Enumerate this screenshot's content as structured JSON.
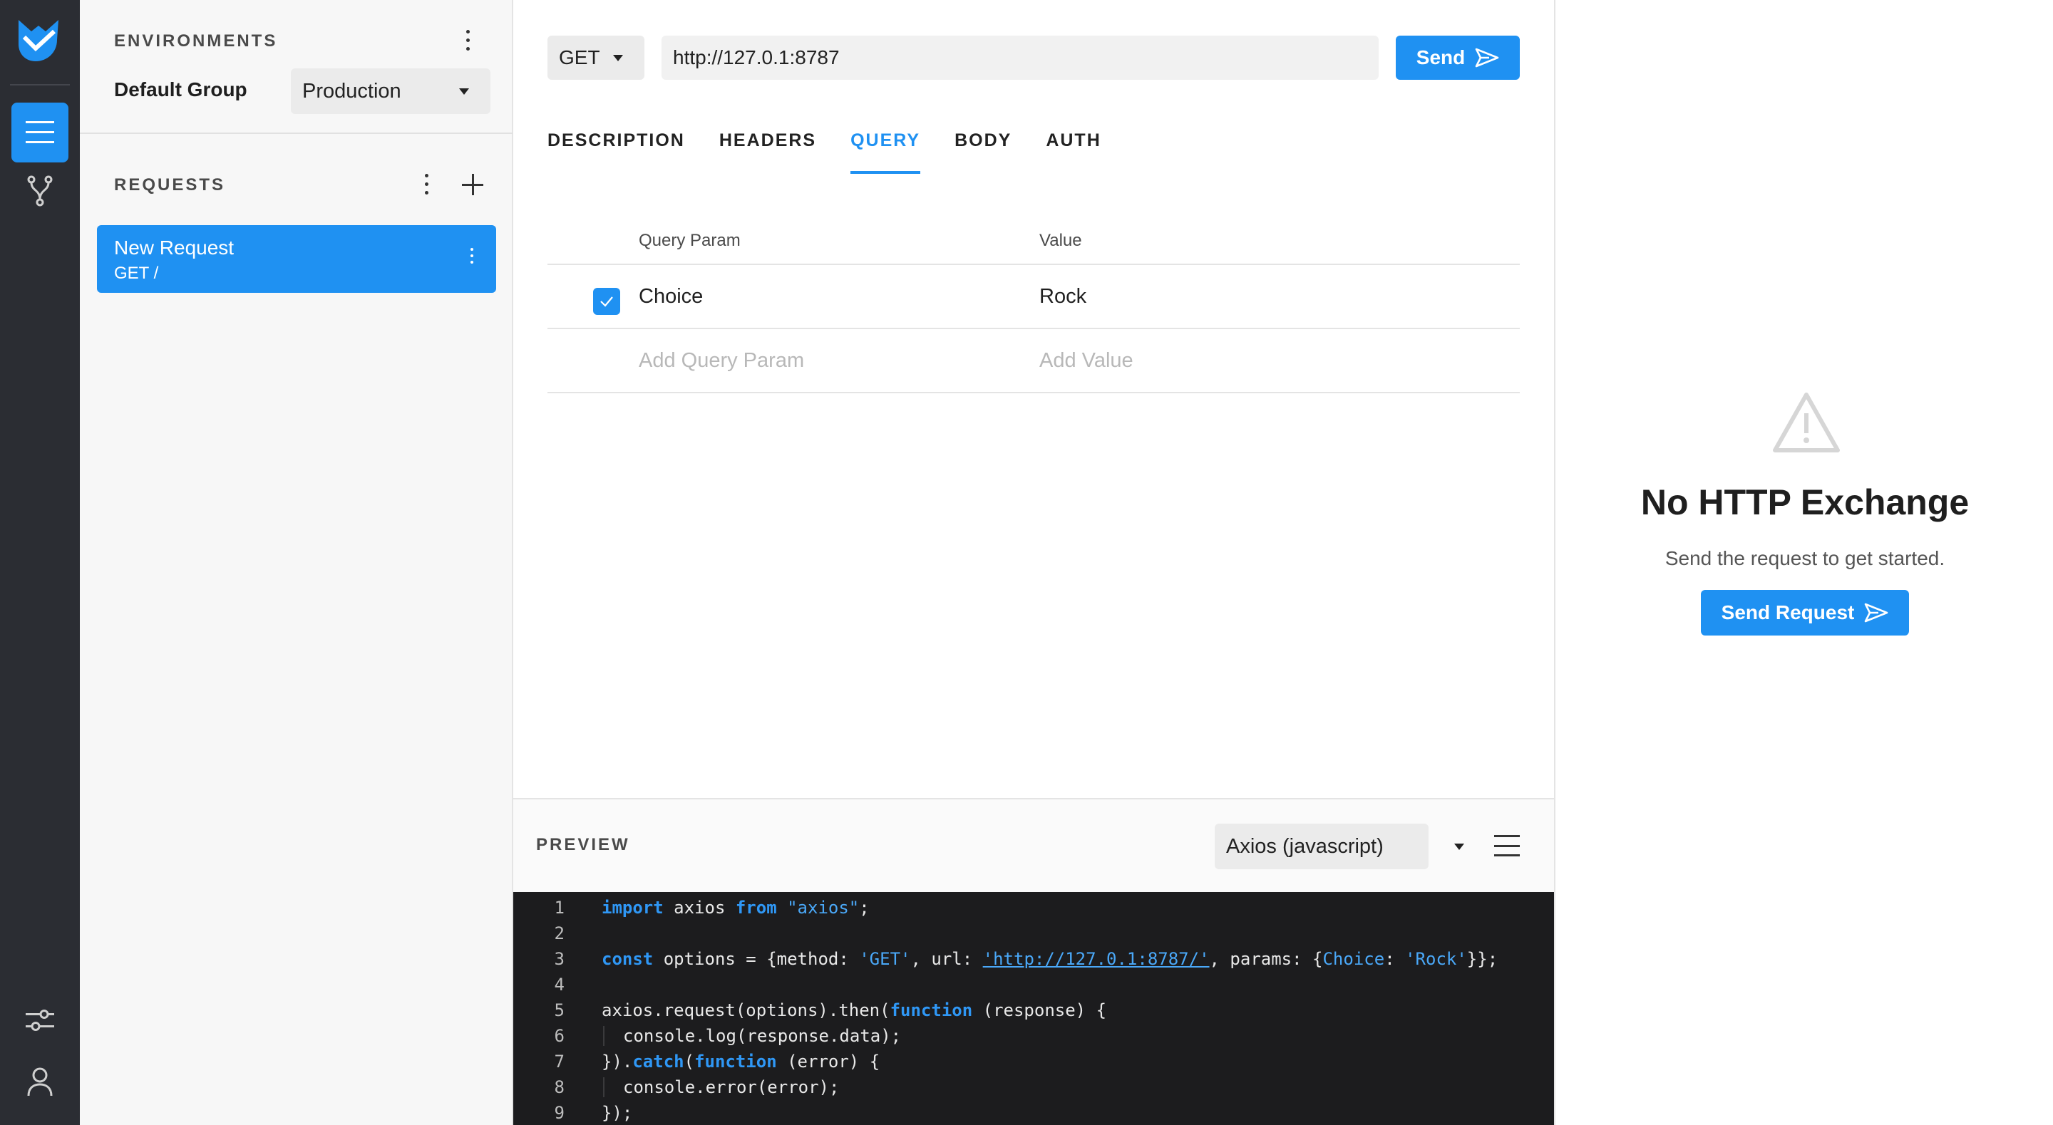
{
  "sidebar": {
    "environments_label": "ENVIRONMENTS",
    "group_name": "Default Group",
    "environment_selected": "Production",
    "requests_label": "REQUESTS",
    "requests": [
      {
        "name": "New Request",
        "sub": "GET /"
      }
    ]
  },
  "request": {
    "method": "GET",
    "url": "http://127.0.1:8787",
    "send_label": "Send",
    "tabs": [
      "DESCRIPTION",
      "HEADERS",
      "QUERY",
      "BODY",
      "AUTH"
    ],
    "active_tab": "QUERY",
    "query": {
      "col_param": "Query Param",
      "col_value": "Value",
      "rows": [
        {
          "param": "Choice",
          "value": "Rock",
          "enabled": true
        }
      ],
      "add_param_placeholder": "Add Query Param",
      "add_value_placeholder": "Add Value"
    }
  },
  "preview": {
    "label": "PREVIEW",
    "language": "Axios (javascript)",
    "code": {
      "l1_kw1": "import",
      "l1_a": " axios ",
      "l1_kw2": "from",
      "l1_b": " ",
      "l1_str": "\"axios\"",
      "l1_c": ";",
      "l3_kw": "const",
      "l3_a": " options = {method: ",
      "l3_s1": "'GET'",
      "l3_b": ", url: ",
      "l3_url": "'http://127.0.1:8787/'",
      "l3_c": ", params: {",
      "l3_key": "Choice",
      "l3_d": ": ",
      "l3_s2": "'Rock'",
      "l3_e": "}};",
      "l5_a": "axios.request(options).then(",
      "l5_kw": "function",
      "l5_b": " (response) {",
      "l6": "console.log(response.data);",
      "l7_a": "}).",
      "l7_kw1": "catch",
      "l7_b": "(",
      "l7_kw2": "function",
      "l7_c": " (error) {",
      "l8": "console.error(error);",
      "l9": "});"
    }
  },
  "response": {
    "title": "No HTTP Exchange",
    "subtitle": "Send the request to get started.",
    "button_label": "Send Request"
  },
  "colors": {
    "accent": "#1f91f2",
    "rail": "#2b2d33"
  }
}
